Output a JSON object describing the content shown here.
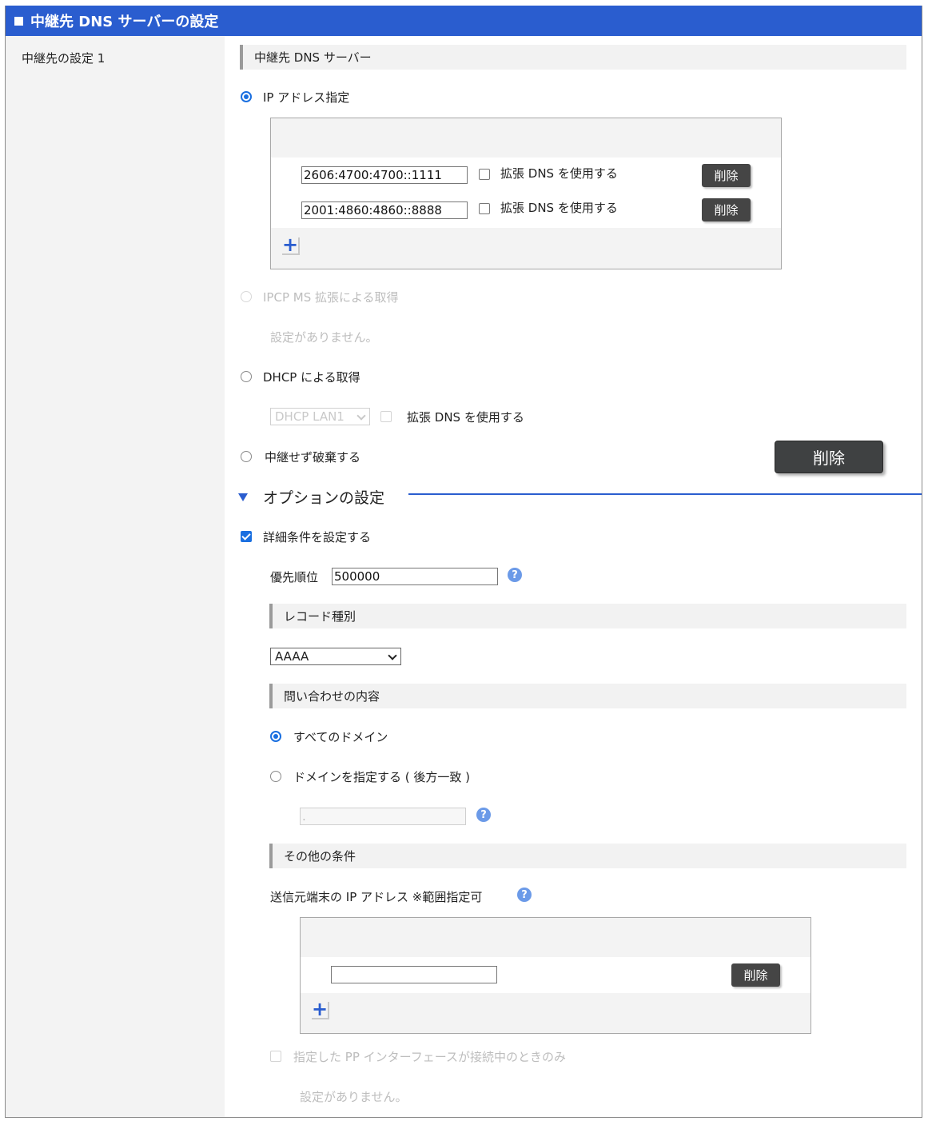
{
  "window": {
    "title": "中継先 DNS サーバーの設定"
  },
  "left": {
    "label": "中継先の設定 1"
  },
  "dns_server": {
    "section_title": "中継先 DNS サーバー",
    "ip_option_label": "IP アドレス指定",
    "servers": [
      {
        "address": "2606:4700:4700::1111",
        "ext_dns_label": "拡張 DNS を使用する",
        "delete_label": "削除"
      },
      {
        "address": "2001:4860:4860::8888",
        "ext_dns_label": "拡張 DNS を使用する",
        "delete_label": "削除"
      }
    ],
    "add_symbol": "+",
    "ipcp_label": "IPCP MS 拡張による取得",
    "ipcp_none": "設定がありません。",
    "dhcp_label": "DHCP による取得",
    "dhcp_select_value": "DHCP LAN1",
    "dhcp_ext_dns_label": "拡張 DNS を使用する",
    "discard_label": "中継せず破棄する",
    "delete_big_label": "削除"
  },
  "options": {
    "title": "オプションの設定",
    "detail_label": "詳細条件を設定する",
    "priority_label": "優先順位",
    "priority_value": "500000",
    "help_symbol": "?",
    "record_section": "レコード種別",
    "record_value": "AAAA",
    "query_section": "問い合わせの内容",
    "all_domains_label": "すべてのドメイン",
    "specify_domain_label": "ドメインを指定する ( 後方一致 )",
    "domain_placeholder": ".",
    "other_section": "その他の条件",
    "source_ip_label": "送信元端末の IP アドレス ※範囲指定可",
    "source_delete_label": "削除",
    "pp_label": "指定した PP インターフェースが接続中のときのみ",
    "pp_none": "設定がありません。"
  },
  "colors": {
    "accent": "#2a5dcf",
    "radio_on": "#1a6fe0",
    "button_dark": "#454545"
  }
}
